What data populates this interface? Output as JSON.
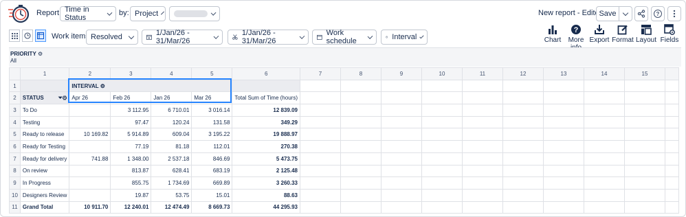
{
  "header": {
    "report_label": "Report:",
    "report_value": "Time in Status",
    "by_label": "by:",
    "by_value": "Project",
    "status_text": "New report - Edited",
    "save_label": "Save",
    "more_icon": "more-vertical-icon",
    "share_icon": "share-icon",
    "help_icon": "help-icon"
  },
  "toolbar": {
    "work_items_label": "Work items:",
    "work_items_value": "Resolved",
    "date_range_1": "1/Jan/26 - 31/Mar/26",
    "date_range_2": "1/Jan/26 - 31/Mar/26",
    "work_schedule": "Work schedule",
    "interval": "Interval",
    "actions": [
      {
        "label": "Chart",
        "icon": "bar-chart-icon"
      },
      {
        "label": "More info",
        "icon": "help-circle-icon"
      },
      {
        "label": "Export",
        "icon": "export-icon"
      },
      {
        "label": "Format",
        "icon": "edit-icon"
      },
      {
        "label": "Layout",
        "icon": "layout-icon"
      },
      {
        "label": "Fields",
        "icon": "fields-icon"
      }
    ]
  },
  "filter": {
    "title": "PRIORITY",
    "value": "All"
  },
  "grid": {
    "col_numbers": [
      "1",
      "2",
      "3",
      "4",
      "5",
      "6",
      "7",
      "8",
      "9",
      "10",
      "11",
      "12",
      "13",
      "14",
      "15"
    ],
    "row_numbers": [
      "1",
      "2",
      "3",
      "4",
      "5",
      "6",
      "7",
      "8",
      "9",
      "10",
      "11"
    ],
    "interval_header": "INTERVAL",
    "status_header": "STATUS",
    "periods": [
      "Apr 26",
      "Feb 26",
      "Jan 26",
      "Mar 26"
    ],
    "total_header": "Total Sum of Time (hours)",
    "rows": [
      {
        "status": "To Do",
        "values": [
          "",
          "3 112.95",
          "6 710.01",
          "3 016.14"
        ],
        "total": "12 839.09"
      },
      {
        "status": "Testing",
        "values": [
          "",
          "97.47",
          "120.24",
          "131.58"
        ],
        "total": "349.29"
      },
      {
        "status": "Ready to release",
        "values": [
          "10 169.82",
          "5 914.89",
          "609.04",
          "3 195.22"
        ],
        "total": "19 888.97"
      },
      {
        "status": "Ready for Testing",
        "values": [
          "",
          "77.19",
          "81.18",
          "112.01"
        ],
        "total": "270.38"
      },
      {
        "status": "Ready for delivery",
        "values": [
          "741.88",
          "1 348.00",
          "2 537.18",
          "846.69"
        ],
        "total": "5 473.75"
      },
      {
        "status": "On review",
        "values": [
          "",
          "813.87",
          "628.41",
          "683.19"
        ],
        "total": "2 125.48"
      },
      {
        "status": "In Progress",
        "values": [
          "",
          "855.75",
          "1 734.69",
          "669.89"
        ],
        "total": "3 260.33"
      },
      {
        "status": "Designers Review",
        "values": [
          "",
          "19.87",
          "53.75",
          "15.01"
        ],
        "total": "88.63"
      }
    ],
    "grand_total": {
      "status": "Grand Total",
      "values": [
        "10 911.70",
        "12 240.01",
        "12 474.49",
        "8 669.73"
      ],
      "total": "44 295.93"
    }
  }
}
